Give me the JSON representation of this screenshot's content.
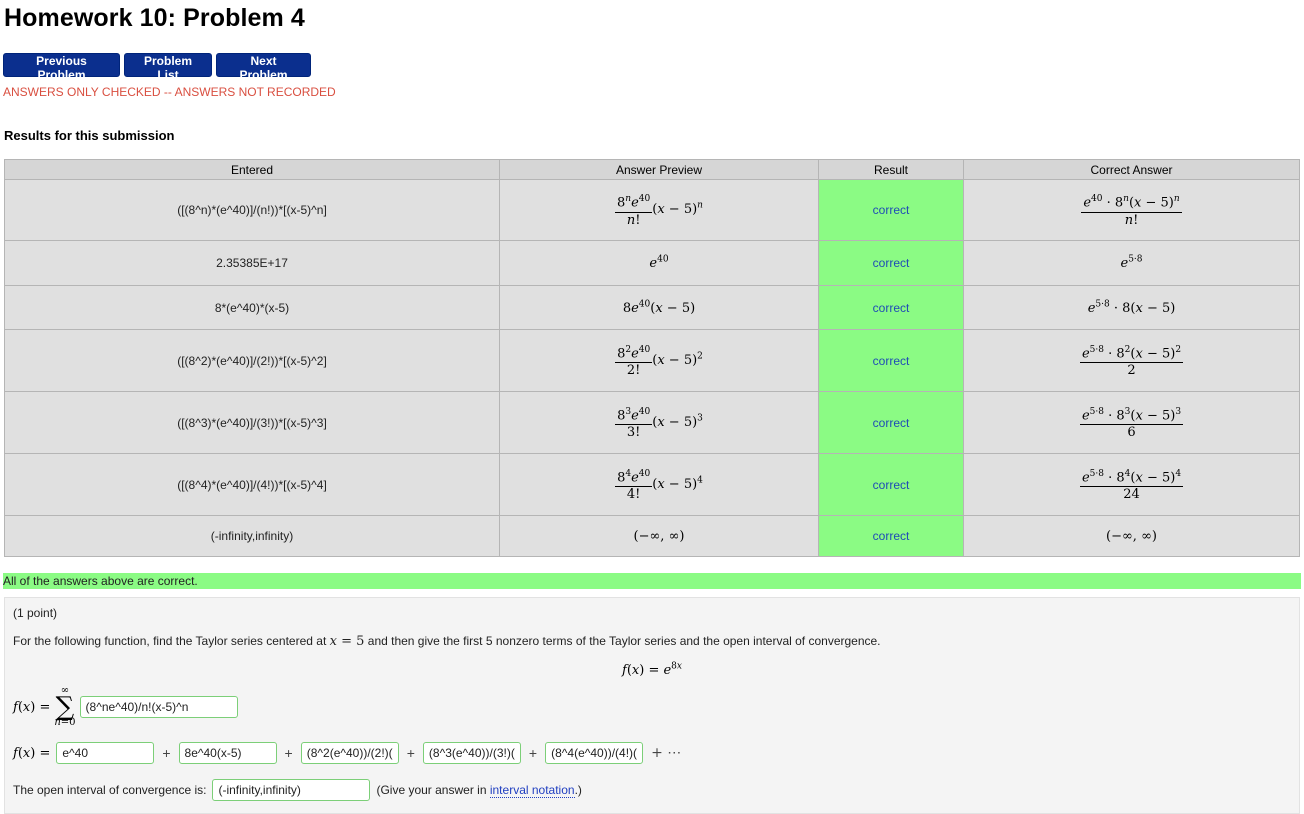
{
  "page": {
    "title": "Homework 10: Problem 4",
    "nav": {
      "prev": "Previous Problem",
      "list": "Problem List",
      "next": "Next Problem"
    },
    "notice": "ANSWERS ONLY CHECKED -- ANSWERS NOT RECORDED",
    "results_heading": "Results for this submission"
  },
  "table": {
    "headers": [
      "Entered",
      "Answer Preview",
      "Result",
      "Correct Answer"
    ],
    "rows": [
      {
        "entered": "([(8^n)*(e^40)]/(n!))*[(x-5)^n]",
        "result": "correct"
      },
      {
        "entered": "2.35385E+17",
        "result": "correct"
      },
      {
        "entered": "8*(e^40)*(x-5)",
        "result": "correct"
      },
      {
        "entered": "([(8^2)*(e^40)]/(2!))*[(x-5)^2]",
        "result": "correct"
      },
      {
        "entered": "([(8^3)*(e^40)]/(3!))*[(x-5)^3]",
        "result": "correct"
      },
      {
        "entered": "([(8^4)*(e^40)]/(4!))*[(x-5)^4]",
        "result": "correct"
      },
      {
        "entered": "(-infinity,infinity)",
        "result": "correct"
      }
    ]
  },
  "summary": "All of the answers above are correct.",
  "problem": {
    "points": "(1 point)",
    "statement_pre": "For the following function, find the Taylor series centered at",
    "statement_var": "x = 5",
    "statement_post": "and then give the first 5 nonzero terms of the Taylor series and the open interval of convergence.",
    "series_input": "(8^ne^40)/n!(x-5)^n",
    "terms": [
      "e^40",
      "8e^40(x-5)",
      "(8^2(e^40))/(2!)(",
      "(8^3(e^40))/(3!)(",
      "(8^4(e^40))/(4!)("
    ],
    "interval_label": "The open interval of convergence is:",
    "interval_input": "(-infinity,infinity)",
    "hint_pre": "(Give your answer in",
    "hint_link": "interval notation",
    "hint_post": ".)"
  }
}
